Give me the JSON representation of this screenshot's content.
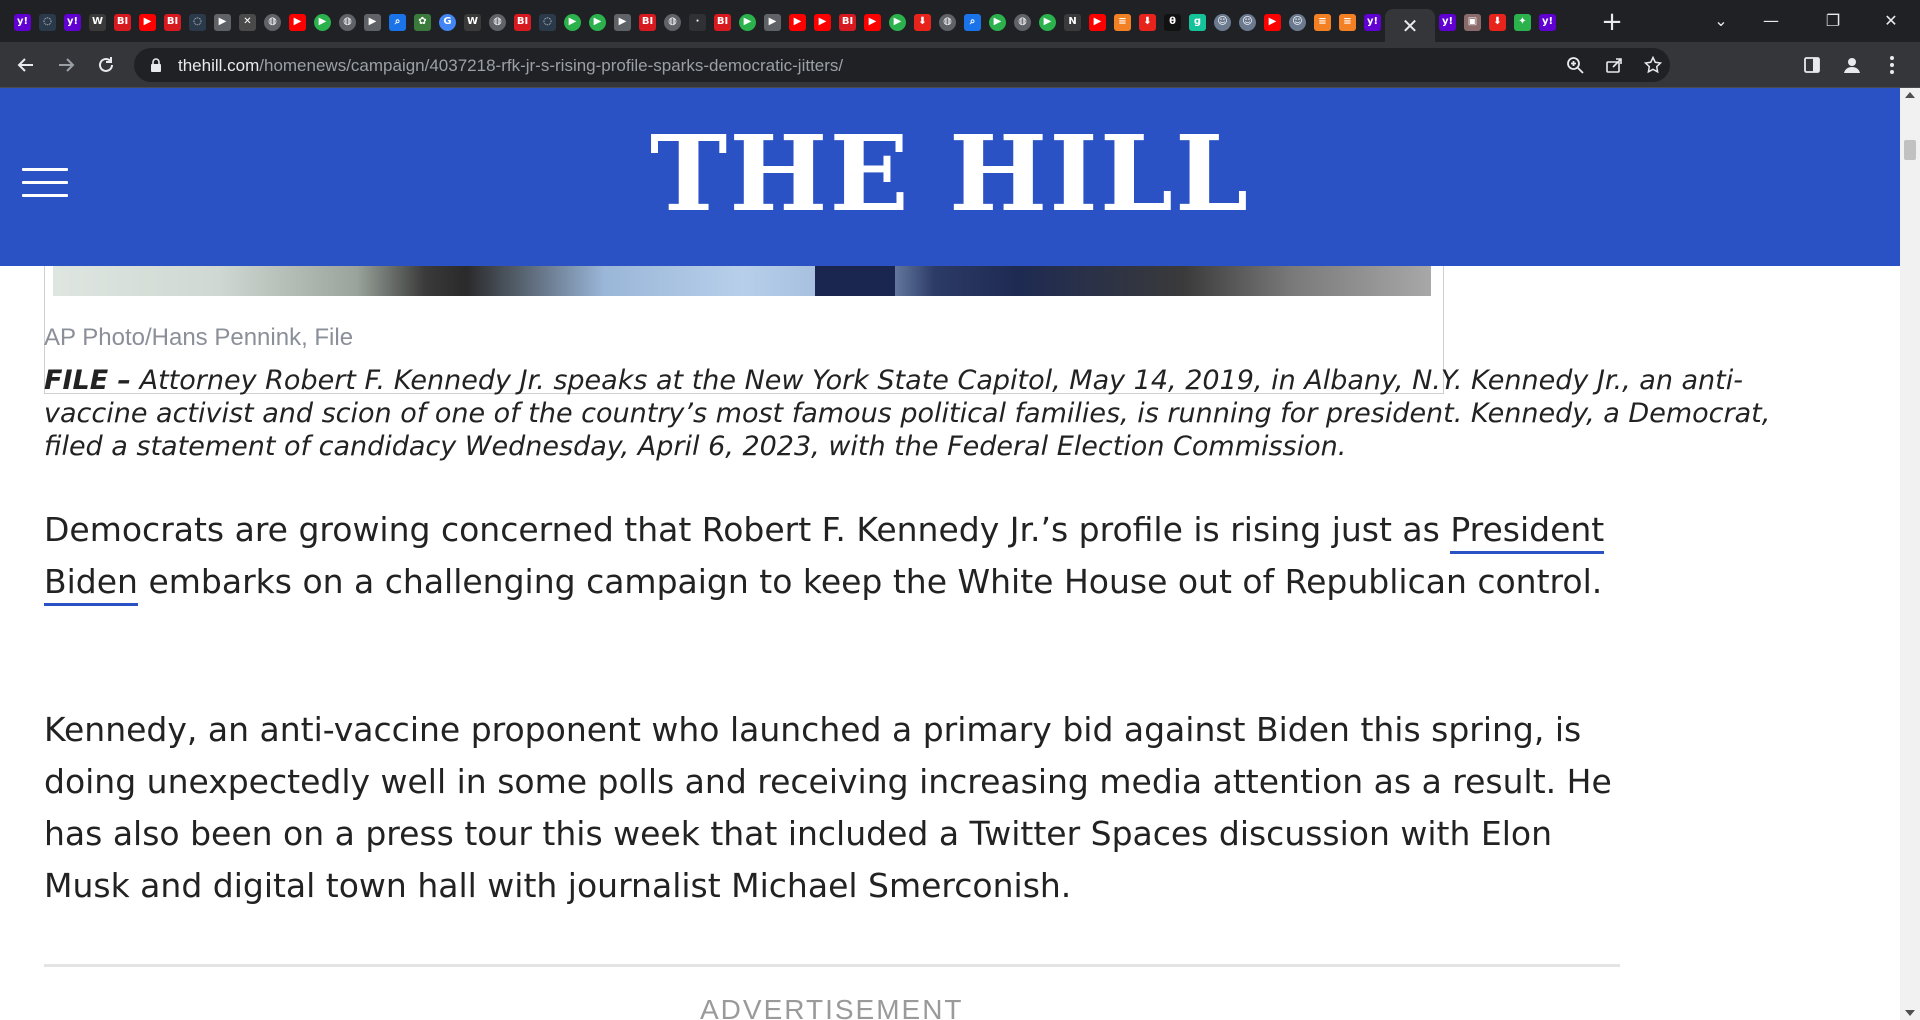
{
  "browser": {
    "tabs": [
      {
        "icon": "yahoo-icon",
        "glyph": "y!",
        "color": "#6001d2"
      },
      {
        "icon": "shield-icon",
        "glyph": "◌",
        "color": "#2b3a4a"
      },
      {
        "icon": "yahoo-icon",
        "glyph": "y!",
        "color": "#6001d2"
      },
      {
        "icon": "wsj-icon",
        "glyph": "W",
        "color": "#3a3a3a"
      },
      {
        "icon": "business-insider-icon",
        "glyph": "BI",
        "color": "#d71920"
      },
      {
        "icon": "youtube-icon",
        "glyph": "▶",
        "color": "#ff0000"
      },
      {
        "icon": "business-insider-icon",
        "glyph": "BI",
        "color": "#d71920"
      },
      {
        "icon": "shield-icon",
        "glyph": "◌",
        "color": "#2b3a4a"
      },
      {
        "icon": "play-next-icon",
        "glyph": "▶",
        "color": "#5f6368"
      },
      {
        "icon": "blocked-image-icon",
        "glyph": "✕",
        "color": "#4a4a4a"
      },
      {
        "icon": "globe-icon",
        "glyph": "◍",
        "color": "#5f6368"
      },
      {
        "icon": "youtube-icon",
        "glyph": "▶",
        "color": "#ff0000"
      },
      {
        "icon": "play-green-icon",
        "glyph": "▶",
        "color": "#2bb24c"
      },
      {
        "icon": "globe-icon",
        "glyph": "◍",
        "color": "#5f6368"
      },
      {
        "icon": "play-next-icon",
        "glyph": "▶",
        "color": "#5f6368"
      },
      {
        "icon": "search-icon",
        "glyph": "⌕",
        "color": "#1a73e8"
      },
      {
        "icon": "tree-icon",
        "glyph": "✿",
        "color": "#3a7a3a"
      },
      {
        "icon": "google-icon",
        "glyph": "G",
        "color": "#4285f4"
      },
      {
        "icon": "wsj-icon",
        "glyph": "W",
        "color": "#3a3a3a"
      },
      {
        "icon": "globe-icon",
        "glyph": "◍",
        "color": "#5f6368"
      },
      {
        "icon": "business-insider-icon",
        "glyph": "BI",
        "color": "#d71920"
      },
      {
        "icon": "shield-icon",
        "glyph": "◌",
        "color": "#2b3a4a"
      },
      {
        "icon": "play-green-icon",
        "glyph": "▶",
        "color": "#2bb24c"
      },
      {
        "icon": "play-green-icon",
        "glyph": "▶",
        "color": "#2bb24c"
      },
      {
        "icon": "play-next-icon",
        "glyph": "▶",
        "color": "#5f6368"
      },
      {
        "icon": "business-insider-icon",
        "glyph": "BI",
        "color": "#d71920"
      },
      {
        "icon": "globe-icon",
        "glyph": "◍",
        "color": "#5f6368"
      },
      {
        "icon": "blank-icon",
        "glyph": "·",
        "color": "#303134"
      },
      {
        "icon": "business-insider-icon",
        "glyph": "BI",
        "color": "#d71920"
      },
      {
        "icon": "play-green-icon",
        "glyph": "▶",
        "color": "#2bb24c"
      },
      {
        "icon": "play-next-icon",
        "glyph": "▶",
        "color": "#5f6368"
      },
      {
        "icon": "youtube-icon",
        "glyph": "▶",
        "color": "#ff0000"
      },
      {
        "icon": "youtube-icon",
        "glyph": "▶",
        "color": "#ff0000"
      },
      {
        "icon": "business-insider-icon",
        "glyph": "BI",
        "color": "#d71920"
      },
      {
        "icon": "youtube-icon",
        "glyph": "▶",
        "color": "#ff0000"
      },
      {
        "icon": "play-green-icon",
        "glyph": "▶",
        "color": "#2bb24c"
      },
      {
        "icon": "download-red-icon",
        "glyph": "⬇",
        "color": "#e8231b"
      },
      {
        "icon": "globe-icon",
        "glyph": "◍",
        "color": "#5f6368"
      },
      {
        "icon": "search-icon",
        "glyph": "⌕",
        "color": "#1a73e8"
      },
      {
        "icon": "play-green-icon",
        "glyph": "▶",
        "color": "#2bb24c"
      },
      {
        "icon": "globe-icon",
        "glyph": "◍",
        "color": "#5f6368"
      },
      {
        "icon": "play-green-icon",
        "glyph": "▶",
        "color": "#2bb24c"
      },
      {
        "icon": "news-icon",
        "glyph": "N",
        "color": "#3a3a3a"
      },
      {
        "icon": "youtube-icon",
        "glyph": "▶",
        "color": "#ff0000"
      },
      {
        "icon": "stack-icon",
        "glyph": "≡",
        "color": "#f48024"
      },
      {
        "icon": "download-red-icon",
        "glyph": "⬇",
        "color": "#e8231b"
      },
      {
        "icon": "dark-icon",
        "glyph": "θ",
        "color": "#111111"
      },
      {
        "icon": "grammarly-icon",
        "glyph": "g",
        "color": "#15c39a"
      },
      {
        "icon": "person-icon",
        "glyph": "☺",
        "color": "#6b7a8f"
      },
      {
        "icon": "person-icon",
        "glyph": "☺",
        "color": "#6b7a8f"
      },
      {
        "icon": "youtube-icon",
        "glyph": "▶",
        "color": "#ff0000"
      },
      {
        "icon": "person-icon",
        "glyph": "☺",
        "color": "#6b7a8f"
      },
      {
        "icon": "stack-icon",
        "glyph": "≡",
        "color": "#f48024"
      },
      {
        "icon": "stack-icon",
        "glyph": "≡",
        "color": "#f48024"
      },
      {
        "icon": "yahoo-icon",
        "glyph": "y!",
        "color": "#6001d2"
      }
    ],
    "active_tab_close": "✕",
    "tabs_after_active": [
      {
        "icon": "yahoo-icon",
        "glyph": "y!",
        "color": "#6001d2"
      },
      {
        "icon": "photo-icon",
        "glyph": "▣",
        "color": "#8a6a6a"
      },
      {
        "icon": "download-red-icon",
        "glyph": "⬇",
        "color": "#e8231b"
      },
      {
        "icon": "feedly-icon",
        "glyph": "✦",
        "color": "#2bb24c"
      },
      {
        "icon": "yahoo-icon",
        "glyph": "y!",
        "color": "#6001d2"
      }
    ],
    "new_tab": "+",
    "window_controls": {
      "tab_search": "⌄",
      "minimize": "—",
      "restore": "❐",
      "close": "✕"
    },
    "url_host": "thehill.com",
    "url_path": "/homenews/campaign/4037218-rfk-jr-s-rising-profile-sparks-democratic-jitters/"
  },
  "site": {
    "logo": "THE HILL",
    "brand_color": "#2b52c4"
  },
  "article": {
    "photo_credit": "AP Photo/Hans Pennink, File",
    "caption_lead": "FILE –",
    "caption_body": " Attorney Robert F. Kennedy Jr. speaks at the New York State Capitol, May 14, 2019, in Albany, N.Y. Kennedy Jr., an anti-vaccine activist and scion of one of the country’s most famous political families, is running for president. Kennedy, a Democrat, filed a statement of candidacy Wednesday, April 6, 2023, with the Federal Election Commission.",
    "para1_before": "Democrats are growing concerned that Robert F. Kennedy Jr.’s profile is rising just as ",
    "para1_link": "President Biden",
    "para1_after": " embarks on a challenging campaign to keep the White House out of Republican control.",
    "para2": "Kennedy, an anti-vaccine proponent who launched a primary bid against Biden this spring, is doing unexpectedly well in some polls and receiving increasing media attention as a result. He has also been on a press tour this week that included a Twitter Spaces discussion with Elon Musk and digital town hall with journalist Michael Smerconish.",
    "ad_label": "ADVERTISEMENT"
  }
}
